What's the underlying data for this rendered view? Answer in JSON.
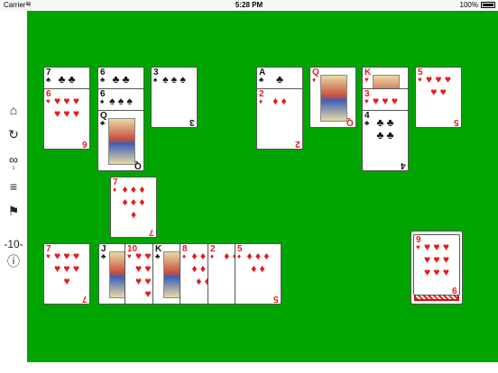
{
  "status": {
    "carrier": "Carrier",
    "time": "5:28 PM",
    "battery": "100%"
  },
  "sidebar": {
    "moves_count": "1",
    "score": "-10-"
  },
  "tableau": {
    "col1": [
      {
        "rank": "7",
        "suit": "♣",
        "color": "black"
      },
      {
        "rank": "6",
        "suit": "♥",
        "color": "red"
      }
    ],
    "col2": [
      {
        "rank": "6",
        "suit": "♣",
        "color": "black"
      },
      {
        "rank": "6",
        "suit": "♠",
        "color": "black"
      },
      {
        "rank": "Q",
        "suit": "♣",
        "color": "black"
      }
    ],
    "col3": [
      {
        "rank": "3",
        "suit": "♠",
        "color": "black"
      }
    ],
    "col4": [
      {
        "rank": "A",
        "suit": "♣",
        "color": "black"
      },
      {
        "rank": "2",
        "suit": "♦",
        "color": "red"
      }
    ],
    "col5": [
      {
        "rank": "Q",
        "suit": "♦",
        "color": "red"
      }
    ],
    "col6": [
      {
        "rank": "K",
        "suit": "♥",
        "color": "red"
      },
      {
        "rank": "3",
        "suit": "♥",
        "color": "red"
      },
      {
        "rank": "4",
        "suit": "♣",
        "color": "black"
      }
    ],
    "col7": [
      {
        "rank": "5",
        "suit": "♥",
        "color": "red"
      }
    ]
  },
  "middle_card": {
    "rank": "7",
    "suit": "♦",
    "color": "red"
  },
  "bottom_row": [
    {
      "rank": "7",
      "suit": "♥",
      "color": "red"
    },
    {
      "rank": "J",
      "suit": "♣",
      "color": "black"
    },
    {
      "rank": "10",
      "suit": "♥",
      "color": "red"
    },
    {
      "rank": "K",
      "suit": "♣",
      "color": "black"
    },
    {
      "rank": "8",
      "suit": "♦",
      "color": "red"
    },
    {
      "rank": "2",
      "suit": "♦",
      "color": "red"
    },
    {
      "rank": "5",
      "suit": "♦",
      "color": "red"
    }
  ],
  "stock": {
    "rank": "9",
    "suit": "♥",
    "color": "red"
  }
}
